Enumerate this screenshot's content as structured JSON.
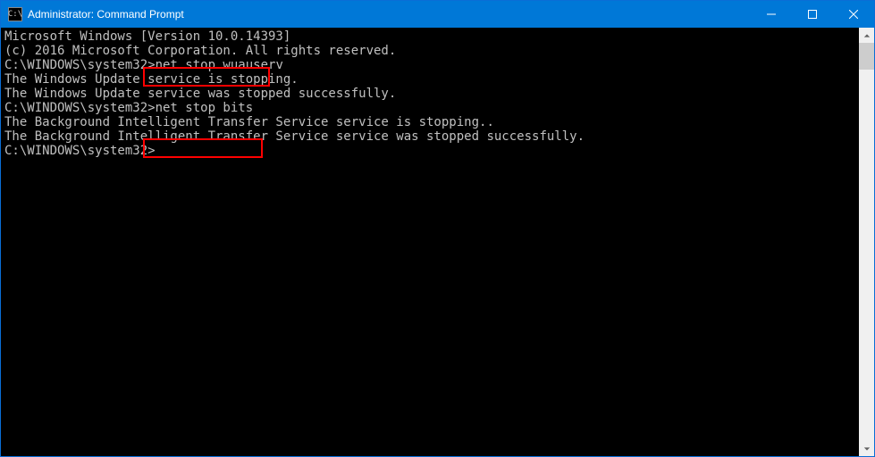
{
  "titlebar": {
    "title": "Administrator: Command Prompt"
  },
  "terminal": {
    "lines": {
      "l0": "Microsoft Windows [Version 10.0.14393]",
      "l1": "(c) 2016 Microsoft Corporation. All rights reserved.",
      "l2": "",
      "prompt1": "C:\\WINDOWS\\system32>",
      "cmd1": "net stop wuauserv",
      "l4": "The Windows Update service is stopping.",
      "l5": "The Windows Update service was stopped successfully.",
      "l6": "",
      "l7": "",
      "prompt2": "C:\\WINDOWS\\system32>",
      "cmd2": "net stop bits",
      "l9": "The Background Intelligent Transfer Service service is stopping..",
      "l10": "The Background Intelligent Transfer Service service was stopped successfully.",
      "l11": "",
      "l12": "",
      "prompt3": "C:\\WINDOWS\\system32>"
    }
  },
  "highlights": [
    {
      "command": "net stop wuauserv"
    },
    {
      "command": "net stop bits"
    }
  ],
  "colors": {
    "titlebar_bg": "#0078d7",
    "terminal_bg": "#000000",
    "terminal_fg": "#c0c0c0",
    "highlight_border": "#ff0000"
  }
}
